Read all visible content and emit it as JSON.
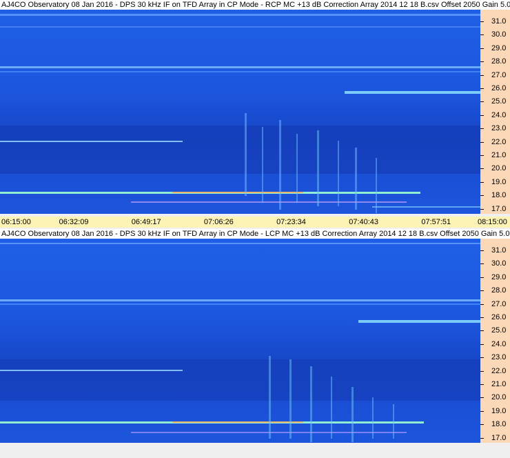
{
  "panels": [
    {
      "header": "AJ4CO Observatory 08 Jan 2016 - DPS 30 kHz IF on TFD Array in CP Mode - RCP  MC +13 dB  Correction Array 2014 12 18 B.csv  Offset 2050  Gain 5.0",
      "yticks": [
        "31.0",
        "30.0",
        "29.0",
        "28.0",
        "27.0",
        "26.0",
        "25.0",
        "24.0",
        "23.0",
        "22.0",
        "21.0",
        "20.0",
        "19.0",
        "18.0",
        "17.0"
      ],
      "xticks": [
        "06:15:00",
        "06:32:09",
        "06:49:17",
        "07:06:26",
        "07:23:34",
        "07:40:43",
        "07:57:51",
        "08:15:00"
      ]
    },
    {
      "header": "AJ4CO Observatory 08 Jan 2016 - DPS 30 kHz IF on TFD Array in CP Mode - LCP  MC +13 dB  Correction Array 2014 12 18 B.csv  Offset 2050  Gain 5.0",
      "yticks": [
        "31.0",
        "30.0",
        "29.0",
        "28.0",
        "27.0",
        "26.0",
        "25.0",
        "24.0",
        "23.0",
        "22.0",
        "21.0",
        "20.0",
        "19.0",
        "18.0",
        "17.0"
      ],
      "xticks": []
    }
  ],
  "colors": {
    "background": "#1c56de",
    "axis_bg": "#fbd9b8",
    "time_bar": "#fdf3b5"
  }
}
